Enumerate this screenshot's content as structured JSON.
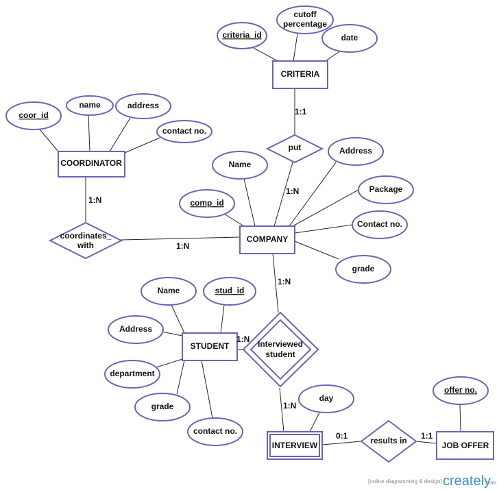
{
  "entities": {
    "criteria": "CRITERIA",
    "coordinator": "COORDINATOR",
    "company": "COMPANY",
    "student": "STUDENT",
    "interview": "INTERVIEW",
    "job_offer": "JOB OFFER"
  },
  "relationships": {
    "put": "put",
    "coordinates_with": [
      "coordinates_",
      "with"
    ],
    "interviewed_student": [
      "Interviewed",
      "student"
    ],
    "results_in": "results in"
  },
  "attributes": {
    "criteria": {
      "criteria_id": "criteria_id",
      "cutoff": [
        "cutoff",
        "percentage"
      ],
      "date": "date"
    },
    "coordinator": {
      "coor_id": "coor_id",
      "name": "name",
      "address": "address",
      "contact": "contact no."
    },
    "company": {
      "name": "Name",
      "comp_id": "comp_id",
      "address": "Address",
      "package": "Package",
      "contact": "Contact no.",
      "grade": "grade"
    },
    "student": {
      "name": "Name",
      "stud_id": "stud_id",
      "address": "Address",
      "department": "department",
      "grade": "grade",
      "contact": "contact no."
    },
    "interview": {
      "day": "day"
    },
    "job_offer": {
      "offer_no": "offer no."
    }
  },
  "cardinalities": {
    "criteria_put": "1:1",
    "put_company": "1:N",
    "coordinator_coordinates": "1:N",
    "coordinates_company": "1:N",
    "company_interviewed": "1:N",
    "student_interviewed": "1:N",
    "interviewed_interview": "1:N",
    "interview_results": "0:1",
    "results_joboffer": "1:1"
  },
  "footer": {
    "tagline": "[online diagramming & design]",
    "brand": "creately",
    "suffix": ".com"
  },
  "colors": {
    "shape_stroke": "#6a63b8",
    "brand": "#3a8fd0"
  }
}
